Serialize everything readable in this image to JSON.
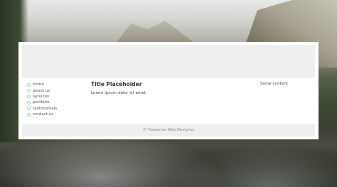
{
  "nav": {
    "items": [
      {
        "label": "home"
      },
      {
        "label": "about us"
      },
      {
        "label": "services"
      },
      {
        "label": "portfolio"
      },
      {
        "label": "testimonials"
      },
      {
        "label": "contact us"
      }
    ]
  },
  "main": {
    "title": "Title Placeholder",
    "body": "Lorem ipsum dolor sit amet"
  },
  "aside": {
    "text": "Some content"
  },
  "footer": {
    "text": "© Freelance Web Designer"
  }
}
